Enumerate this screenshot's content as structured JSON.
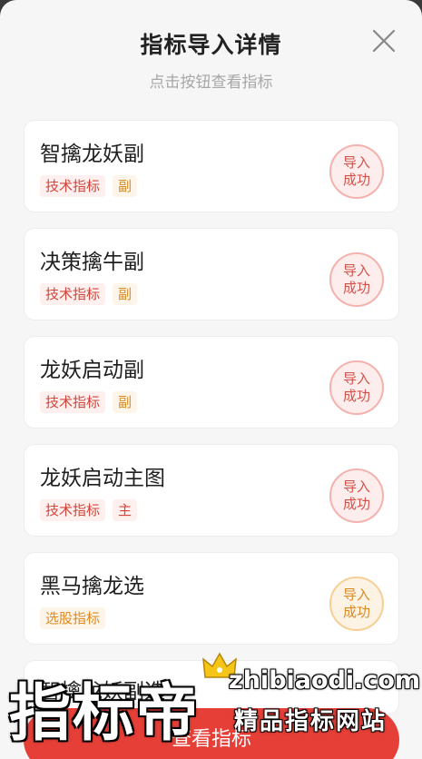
{
  "dialog": {
    "title": "指标导入详情",
    "subtitle": "点击按钮查看指标"
  },
  "items": [
    {
      "name": "智擒龙妖副",
      "type_tag": "技术指标",
      "extra_tag": "副",
      "status": "导入成功",
      "status_line1": "导入",
      "status_line2": "成功",
      "status_color": "red"
    },
    {
      "name": "决策擒牛副",
      "type_tag": "技术指标",
      "extra_tag": "副",
      "status": "导入成功",
      "status_line1": "导入",
      "status_line2": "成功",
      "status_color": "red"
    },
    {
      "name": "龙妖启动副",
      "type_tag": "技术指标",
      "extra_tag": "副",
      "status": "导入成功",
      "status_line1": "导入",
      "status_line2": "成功",
      "status_color": "red"
    },
    {
      "name": "龙妖启动主图",
      "type_tag": "技术指标",
      "extra_tag": "主",
      "status": "导入成功",
      "status_line1": "导入",
      "status_line2": "成功",
      "status_color": "red"
    },
    {
      "name": "黑马擒龙选",
      "type_tag": "选股指标",
      "extra_tag": "",
      "status": "导入成功",
      "status_line1": "导入",
      "status_line2": "成功",
      "status_color": "orange"
    }
  ],
  "partial_item": {
    "name": "智擒龙妖副选"
  },
  "bottom_button": {
    "label": "查看指标"
  },
  "watermark": {
    "brand": "指标帝",
    "url": "zhibiaodi.com",
    "slogan": "精品指标网站"
  },
  "colors": {
    "accent": "#e53f37",
    "success_red": "#d2524a",
    "success_orange": "#d98a24"
  }
}
